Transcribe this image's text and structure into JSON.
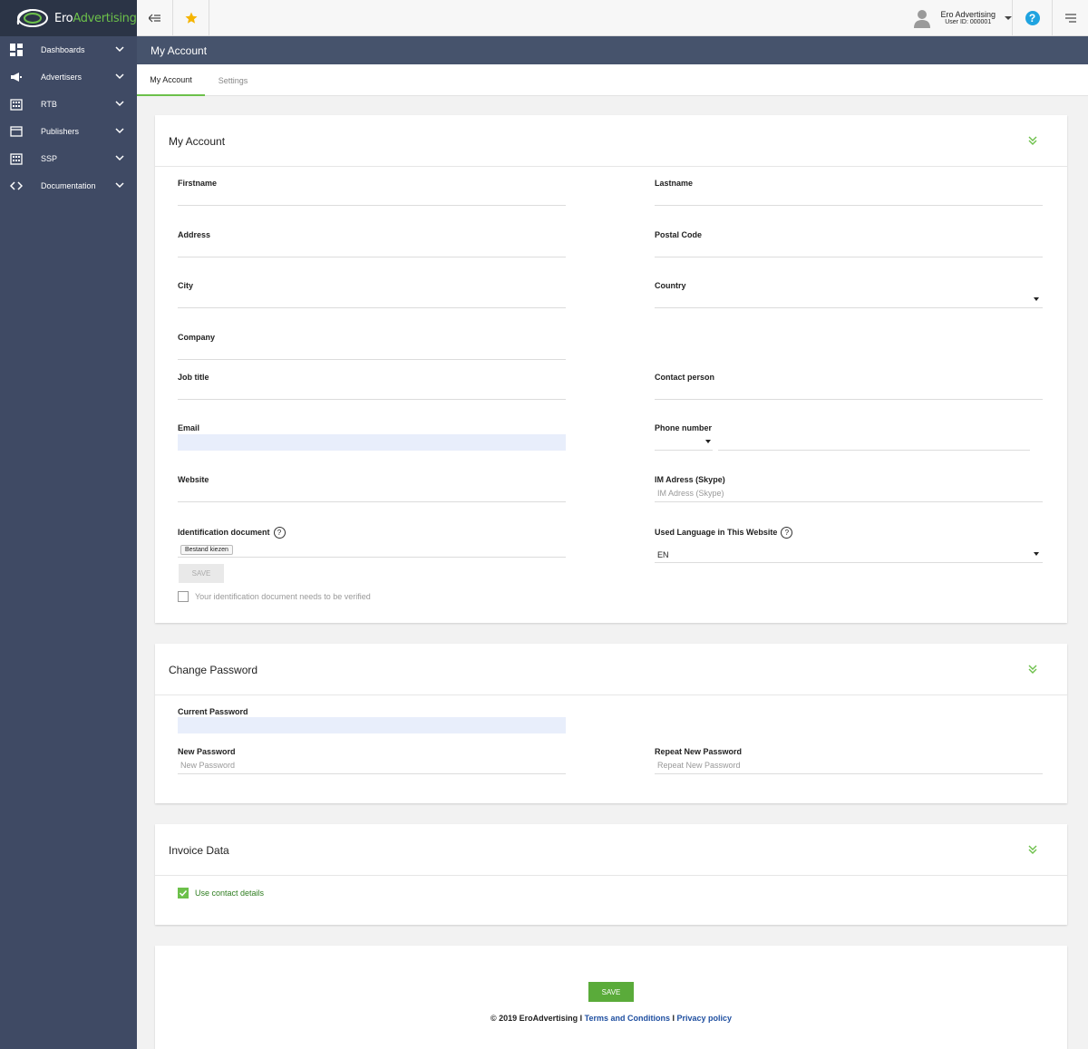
{
  "brand": {
    "name_part1": "Ero",
    "name_part2": "Advertising",
    "accent": "#6cc04a"
  },
  "sidebar": {
    "items": [
      {
        "label": "Dashboards",
        "icon": "dashboard-icon"
      },
      {
        "label": "Advertisers",
        "icon": "megaphone-icon"
      },
      {
        "label": "RTB",
        "icon": "building-icon"
      },
      {
        "label": "Publishers",
        "icon": "browser-window-icon"
      },
      {
        "label": "SSP",
        "icon": "building-icon"
      },
      {
        "label": "Documentation",
        "icon": "code-icon"
      }
    ]
  },
  "topbar": {
    "user_name": "Ero Advertising",
    "user_id": "User ID: 000001",
    "help_label": "?"
  },
  "page": {
    "title": "My Account"
  },
  "tabs": [
    {
      "label": "My Account",
      "active": true
    },
    {
      "label": "Settings",
      "active": false
    }
  ],
  "account": {
    "title": "My Account",
    "firstname": "Firstname",
    "lastname": "Lastname",
    "address": "Address",
    "postal_code": "Postal Code",
    "city": "City",
    "country": "Country",
    "company": "Company",
    "job_title": "Job title",
    "contact_person": "Contact person",
    "email": "Email",
    "phone_number": "Phone number",
    "website": "Website",
    "im_address": "IM Adress (Skype)",
    "im_placeholder": "IM Adress (Skype)",
    "id_document": "Identification document",
    "file_button": "Bestand kiezen",
    "save_label": "SAVE",
    "verify_label": "Your identification document needs to be verified",
    "language_label": "Used Language in This Website",
    "language_value": "EN"
  },
  "password": {
    "title": "Change Password",
    "current": "Current Password",
    "new": "New Password",
    "new_placeholder": "New Password",
    "repeat": "Repeat New Password",
    "repeat_placeholder": "Repeat New Password"
  },
  "invoice": {
    "title": "Invoice Data",
    "use_contact": "Use contact details"
  },
  "footer": {
    "save_label": "SAVE",
    "copyright": "© 2019 EroAdvertising I ",
    "terms": "Terms and Conditions",
    "sep": " I ",
    "privacy": "Privacy policy"
  }
}
